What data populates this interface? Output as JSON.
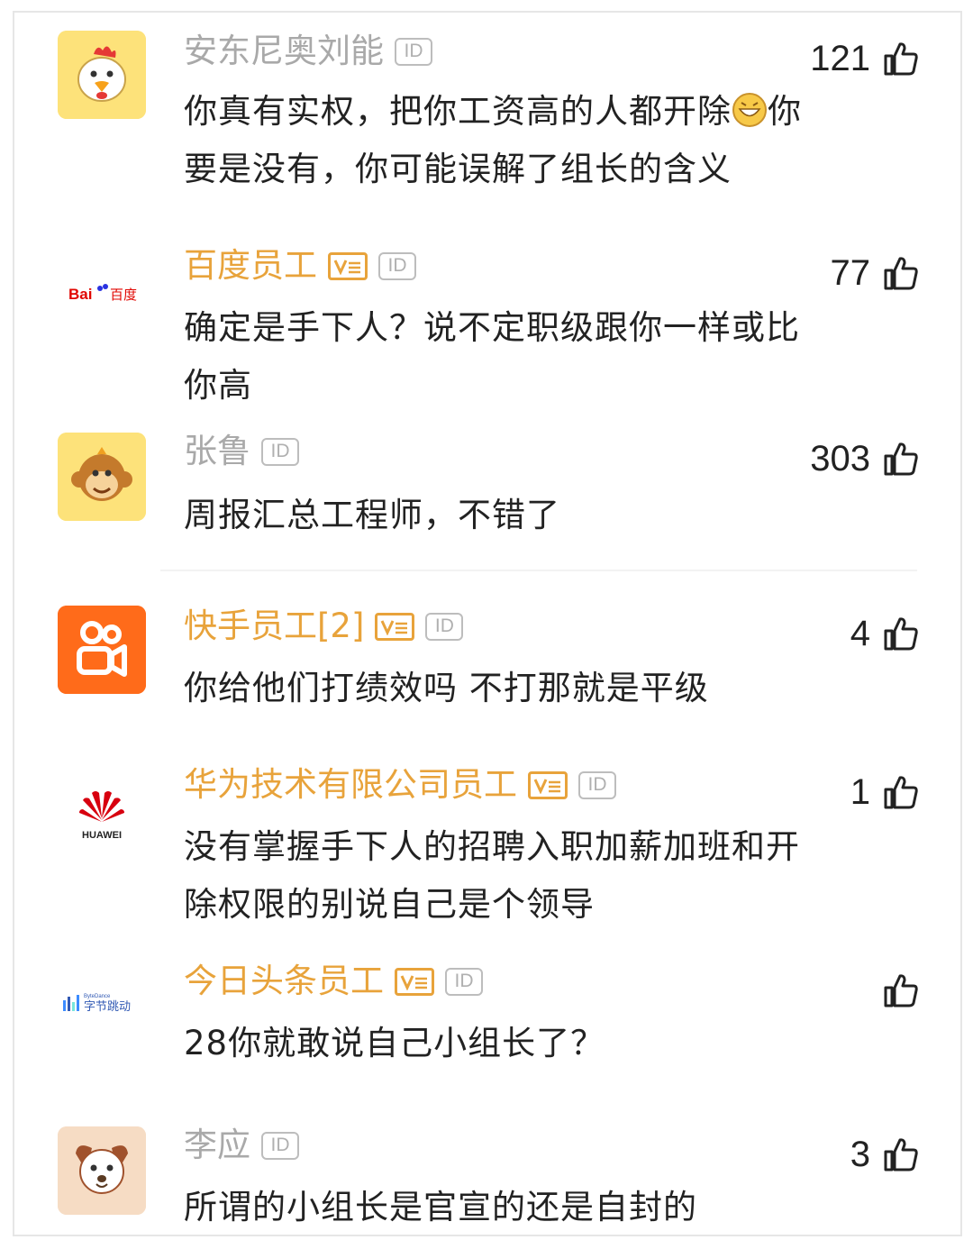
{
  "comments": [
    {
      "username": "安东尼奥刘能",
      "verified": false,
      "id_badge": "ID",
      "likes": "121",
      "text_line1": "你真有实权，把你工资高的人都开除",
      "emoji": "grinning-emoji",
      "text_line1b": "你",
      "text_line2": "要是没有，你可能误解了组长的含义",
      "avatar": "chicken-avatar"
    },
    {
      "username": "百度员工",
      "verified": true,
      "id_badge": "ID",
      "likes": "77",
      "text_line1": "确定是手下人？说不定职级跟你一样或比",
      "text_line2": "你高",
      "avatar": "baidu-logo",
      "logo_text_a": "Bai",
      "logo_text_b": "百度"
    },
    {
      "username": "张鲁",
      "verified": false,
      "id_badge": "ID",
      "likes": "303",
      "text_line1": "周报汇总工程师，不错了",
      "avatar": "monkey-avatar"
    },
    {
      "username": "快手员工[2]",
      "verified": true,
      "id_badge": "ID",
      "likes": "4",
      "text_line1": "你给他们打绩效吗 不打那就是平级",
      "avatar": "kuaishou-logo"
    },
    {
      "username": "华为技术有限公司员工",
      "verified": true,
      "id_badge": "ID",
      "likes": "1",
      "text_line1": "没有掌握手下人的招聘入职加薪加班和开",
      "text_line2": "除权限的别说自己是个领导",
      "avatar": "huawei-logo",
      "logo_text": "HUAWEI"
    },
    {
      "username": "今日头条员工",
      "verified": true,
      "id_badge": "ID",
      "likes": "",
      "text_line1": "28你就敢说自己小组长了？",
      "avatar": "bytedance-logo",
      "logo_text_small": "ByteDance",
      "logo_text": "字节跳动"
    },
    {
      "username": "李应",
      "verified": false,
      "id_badge": "ID",
      "likes": "3",
      "text_line1": "所谓的小组长是官宣的还是自封的",
      "avatar": "dog-avatar"
    }
  ],
  "colors": {
    "verified_name": "#e8a33b",
    "plain_name": "#a9a9a9",
    "text": "#222222",
    "avatar_yellow": "#fde27a",
    "kuaishou_orange": "#ff6b1a",
    "huawei_red": "#d7000f",
    "baidu_blue": "#2932e1",
    "baidu_red": "#e10601"
  }
}
